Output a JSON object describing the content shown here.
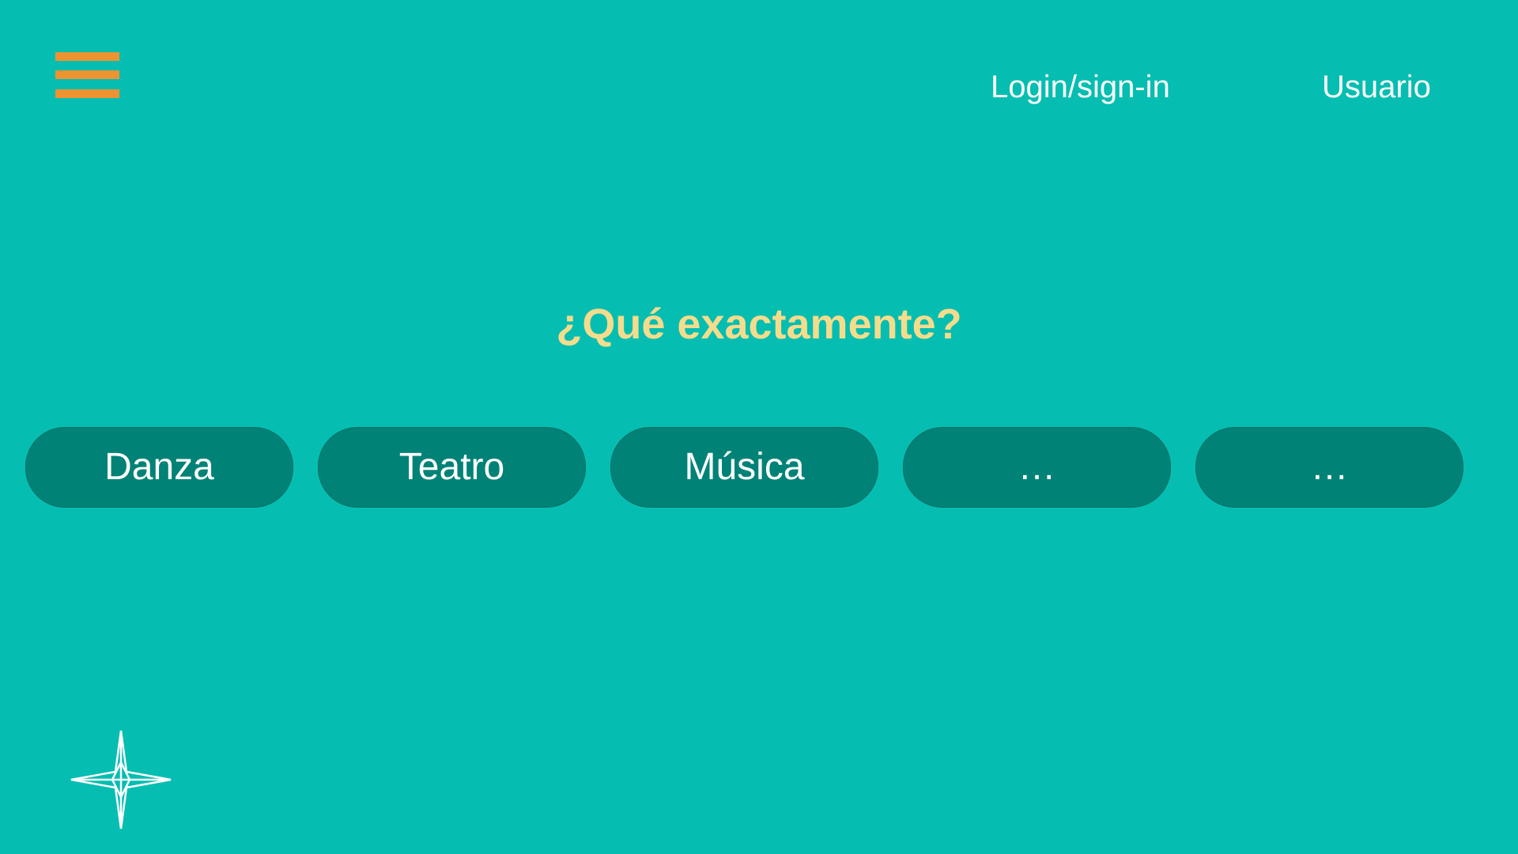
{
  "header": {
    "menu_icon": "hamburger-menu-icon",
    "menu_color": "#EE9331",
    "login_label": "Login/sign-in",
    "user_label": "Usuario"
  },
  "main": {
    "question": "¿Qué exactamente?",
    "question_color": "#F5DC8C",
    "options": [
      {
        "label": "Danza"
      },
      {
        "label": "Teatro"
      },
      {
        "label": "Música"
      },
      {
        "label": "…"
      },
      {
        "label": "…"
      }
    ]
  },
  "footer": {
    "logo_icon": "compass-star-icon"
  },
  "colors": {
    "background": "#05BEB1",
    "pill": "#008276",
    "text": "#FFFFFF"
  }
}
